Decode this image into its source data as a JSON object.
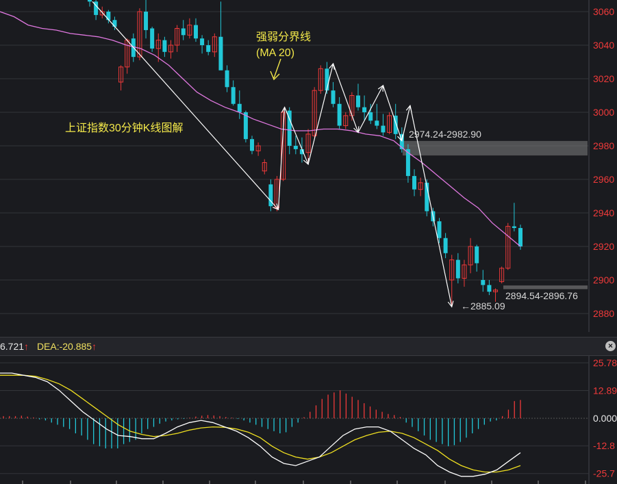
{
  "annotations": {
    "title": "上证指数30分钟K线图解",
    "ma_label_line1": "强弱分界线",
    "ma_label_line2": "(MA 20)",
    "resistance_zone": "2974.24-2982.90",
    "support_zone": "2894.54-2896.76",
    "low_point": "←2885.09"
  },
  "macd_header": {
    "diff_text": "6.721",
    "dea_text": "DEA:-20.885",
    "close_symbol": "×"
  },
  "colors": {
    "up": "#f03a3a",
    "down": "#22c8d8",
    "ma": "#e078e0",
    "dif": "#ffffff",
    "dea": "#f0e020",
    "grid": "#33353a",
    "axis_text": "#f03a3a",
    "zone": "#808080"
  },
  "chart_data": [
    {
      "type": "candlestick",
      "y_ticks": [
        "3060",
        "3040",
        "3020",
        "3000",
        "2980",
        "2960",
        "2940",
        "2920",
        "2900",
        "2880"
      ],
      "ylim": [
        2874,
        3067
      ],
      "candles": [
        [
          3070,
          3072,
          3063,
          3066
        ],
        [
          3066,
          3067,
          3055,
          3058
        ],
        [
          3058,
          3063,
          3056,
          3060
        ],
        [
          3060,
          3061,
          3053,
          3055
        ],
        [
          3055,
          3057,
          3049,
          3051
        ],
        [
          3018,
          3028,
          3013,
          3027
        ],
        [
          3027,
          3044,
          3023,
          3043
        ],
        [
          3044,
          3047,
          3030,
          3033
        ],
        [
          3033,
          3062,
          3031,
          3060
        ],
        [
          3060,
          3068,
          3044,
          3049
        ],
        [
          3050,
          3051,
          3036,
          3038
        ],
        [
          3038,
          3047,
          3030,
          3043
        ],
        [
          3043,
          3045,
          3033,
          3036
        ],
        [
          3036,
          3043,
          3032,
          3040
        ],
        [
          3040,
          3052,
          3036,
          3050
        ],
        [
          3050,
          3055,
          3043,
          3046
        ],
        [
          3046,
          3056,
          3044,
          3052
        ],
        [
          3052,
          3056,
          3042,
          3044
        ],
        [
          3044,
          3046,
          3035,
          3040
        ],
        [
          3040,
          3043,
          3034,
          3036
        ],
        [
          3036,
          3047,
          3033,
          3045
        ],
        [
          3045,
          3066,
          3038,
          3025
        ],
        [
          3025,
          3028,
          3012,
          3015
        ],
        [
          3015,
          3019,
          3004,
          3005
        ],
        [
          3005,
          3013,
          2996,
          3000
        ],
        [
          3000,
          3001,
          2982,
          2984
        ],
        [
          2984,
          2986,
          2975,
          2977
        ],
        [
          2977,
          2982,
          2974,
          2980
        ],
        [
          2965,
          2972,
          2963,
          2970
        ],
        [
          2957,
          2960,
          2941,
          2944
        ],
        [
          2943,
          2962,
          2941,
          2960
        ],
        [
          2960,
          3002,
          2959,
          3000
        ],
        [
          3001,
          3003,
          2975,
          2980
        ],
        [
          2980,
          2986,
          2975,
          2978
        ],
        [
          2978,
          2985,
          2970,
          2975
        ],
        [
          2976,
          2990,
          2970,
          2987
        ],
        [
          2986,
          3015,
          2985,
          3013
        ],
        [
          3013,
          3028,
          3011,
          3026
        ],
        [
          3026,
          3030,
          3011,
          3013
        ],
        [
          3013,
          3018,
          3003,
          3005
        ],
        [
          3005,
          3009,
          2990,
          2992
        ],
        [
          2992,
          3000,
          2990,
          2998
        ],
        [
          2998,
          3012,
          2995,
          3010
        ],
        [
          3010,
          3017,
          3001,
          3003
        ],
        [
          3003,
          3010,
          2995,
          3000
        ],
        [
          3000,
          3005,
          2993,
          2995
        ],
        [
          2995,
          3005,
          2990,
          2992
        ],
        [
          2992,
          2999,
          2986,
          2988
        ],
        [
          2988,
          3000,
          2987,
          2998
        ],
        [
          2998,
          3005,
          2984,
          2987
        ],
        [
          2987,
          2991,
          2976,
          2978
        ],
        [
          2978,
          2981,
          2958,
          2962
        ],
        [
          2962,
          2966,
          2950,
          2954
        ],
        [
          2954,
          2961,
          2950,
          2958
        ],
        [
          2958,
          2960,
          2938,
          2941
        ],
        [
          2941,
          2943,
          2932,
          2935
        ],
        [
          2935,
          2937,
          2922,
          2925
        ],
        [
          2925,
          2928,
          2913,
          2916
        ],
        [
          2900,
          2915,
          2885,
          2912
        ],
        [
          2912,
          2916,
          2898,
          2901
        ],
        [
          2901,
          2912,
          2896,
          2909
        ],
        [
          2909,
          2925,
          2904,
          2920
        ],
        [
          2920,
          2921,
          2905,
          2910
        ],
        [
          2900,
          2906,
          2893,
          2897
        ],
        [
          2897,
          2900,
          2891,
          2893
        ],
        [
          2893,
          2895,
          2887,
          2894
        ],
        [
          2899,
          2908,
          2898,
          2907
        ],
        [
          2907,
          2934,
          2906,
          2932
        ],
        [
          2932,
          2946,
          2929,
          2931
        ],
        [
          2931,
          2933,
          2918,
          2920
        ]
      ],
      "ma20": [
        3060,
        3057,
        3052,
        3050,
        3049,
        3047,
        3046,
        3045,
        3043,
        3040,
        3038,
        3034,
        3028,
        3020,
        3012,
        3007,
        3003,
        3000,
        2996,
        2993,
        2990,
        2989,
        2989,
        2990,
        2990,
        2989,
        2987,
        2986,
        2983,
        2976,
        2970,
        2963,
        2956,
        2949,
        2943,
        2934,
        2927,
        2920
      ]
    },
    {
      "type": "macd",
      "y_ticks": [
        "25.78",
        "12.89",
        "0.000",
        "-12.8",
        "-25.7"
      ],
      "ylim": [
        -27,
        27
      ],
      "dif": [
        21,
        21,
        20,
        19,
        17,
        13,
        8,
        3,
        -1,
        -5,
        -8,
        -8.5,
        -9.5,
        -9.5,
        -7,
        -4,
        -2,
        -1,
        -2,
        -4,
        -6,
        -9,
        -13,
        -18,
        -21,
        -22,
        -20,
        -18,
        -13,
        -8,
        -5,
        -4,
        -4,
        -6,
        -10,
        -14,
        -17,
        -22,
        -25,
        -27,
        -27,
        -26,
        -24,
        -20,
        -16
      ],
      "dea": [
        20,
        20,
        20,
        19.5,
        18,
        16,
        13,
        9,
        5,
        1,
        -3,
        -6,
        -7.5,
        -8.5,
        -8,
        -7,
        -5.5,
        -4.5,
        -4,
        -4.2,
        -5,
        -6.5,
        -9,
        -13,
        -16,
        -18,
        -19,
        -18,
        -16,
        -13,
        -10,
        -8,
        -6.5,
        -6,
        -7,
        -9,
        -12,
        -15,
        -19,
        -22,
        -24,
        -25,
        -25,
        -24,
        -22
      ],
      "hist": [
        1,
        1,
        1,
        1.2,
        0.8,
        0.4,
        -0.5,
        -1,
        -2,
        -3,
        -4,
        -5,
        -7,
        -8,
        -10,
        -12,
        -13,
        -14,
        -14,
        -14,
        -12,
        -11,
        -10,
        -7,
        -5,
        -4,
        -2.5,
        -1.5,
        -1,
        -0.5,
        -0.3,
        0.3,
        0.8,
        1.2,
        1.5,
        1.3,
        1,
        0.6,
        0.3,
        -0.3,
        -1,
        -2,
        -3,
        -4,
        -5,
        -6,
        -7,
        -6.5,
        -4,
        -2,
        0.5,
        3,
        6,
        9,
        11,
        12,
        13,
        11.5,
        10,
        8.5,
        7,
        5.5,
        4,
        3,
        2,
        1.5,
        0.6,
        -2,
        -4,
        -6,
        -8,
        -10,
        -11,
        -12,
        -13,
        -12.5,
        -11,
        -9,
        -7,
        -5,
        -3,
        -1.5,
        -1,
        1,
        4,
        8,
        8.5
      ]
    }
  ]
}
